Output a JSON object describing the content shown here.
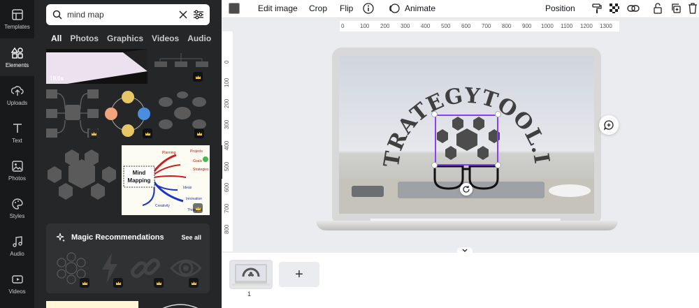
{
  "rail": {
    "items": [
      {
        "label": "Templates",
        "icon": "templates-icon"
      },
      {
        "label": "Elements",
        "icon": "elements-icon"
      },
      {
        "label": "Uploads",
        "icon": "uploads-icon"
      },
      {
        "label": "Text",
        "icon": "text-icon"
      },
      {
        "label": "Photos",
        "icon": "photos-icon"
      },
      {
        "label": "Styles",
        "icon": "styles-icon"
      },
      {
        "label": "Audio",
        "icon": "audio-icon"
      },
      {
        "label": "Videos",
        "icon": "videos-icon"
      }
    ],
    "active": "Elements"
  },
  "search": {
    "value": "mind map"
  },
  "tabs": [
    "All",
    "Photos",
    "Graphics",
    "Videos",
    "Audio"
  ],
  "active_tab": "All",
  "video_duration": "19.0s",
  "mindmap_image": {
    "title": "Mind Mapping",
    "branches": [
      "Planning",
      "Projects",
      "Goals",
      "Strategies",
      "Ideas",
      "Creativity",
      "Innovation",
      "Thoughts"
    ]
  },
  "magic": {
    "title": "Magic Recommendations",
    "see_all": "See all"
  },
  "toolbar": {
    "edit_image": "Edit image",
    "crop": "Crop",
    "flip": "Flip",
    "animate": "Animate",
    "position": "Position",
    "swatch_color": "#4b4b4b"
  },
  "ruler_top": [
    "0",
    "100",
    "200",
    "300",
    "400",
    "500",
    "600",
    "700",
    "800",
    "900",
    "1000",
    "1100",
    "1200",
    "1300"
  ],
  "ruler_left": [
    "0",
    "100",
    "200",
    "300",
    "400",
    "500",
    "600",
    "700",
    "800"
  ],
  "design": {
    "arc_text": "STRATEGYTOOL.IO"
  },
  "pages": {
    "page_number": "1",
    "add_label": "+"
  },
  "colors": {
    "accent": "#8b3dff",
    "panel": "#252627",
    "rail": "#18191b"
  }
}
